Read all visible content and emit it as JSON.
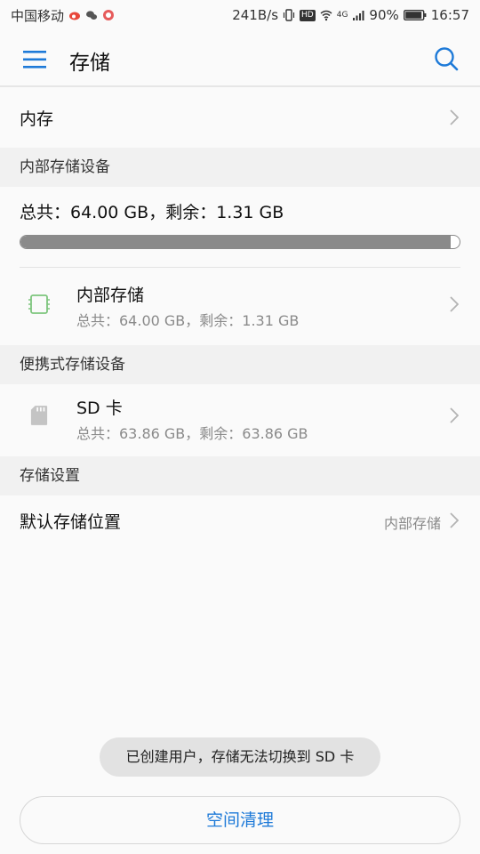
{
  "status_bar": {
    "carrier": "中国移动",
    "speed": "241B/s",
    "battery": "90%",
    "time": "16:57",
    "network": "4G",
    "hd": "HD"
  },
  "header": {
    "title": "存储"
  },
  "memory_row": {
    "label": "内存"
  },
  "internal_section": {
    "header": "内部存储设备",
    "summary": "总共：64.00 GB，剩余：1.31 GB",
    "usage_fraction": 0.98,
    "item": {
      "name": "内部存储",
      "detail": "总共：64.00 GB，剩余：1.31 GB"
    }
  },
  "portable_section": {
    "header": "便携式存储设备",
    "item": {
      "name": "SD 卡",
      "detail": "总共：63.86 GB，剩余：63.86 GB"
    }
  },
  "settings_section": {
    "header": "存储设置",
    "default_location_label": "默认存储位置",
    "default_location_value": "内部存储"
  },
  "toast": "已创建用户，存储无法切换到 SD 卡",
  "clean_button": "空间清理",
  "colors": {
    "accent": "#1e7ad8",
    "chip_icon": "#7dc57d"
  }
}
